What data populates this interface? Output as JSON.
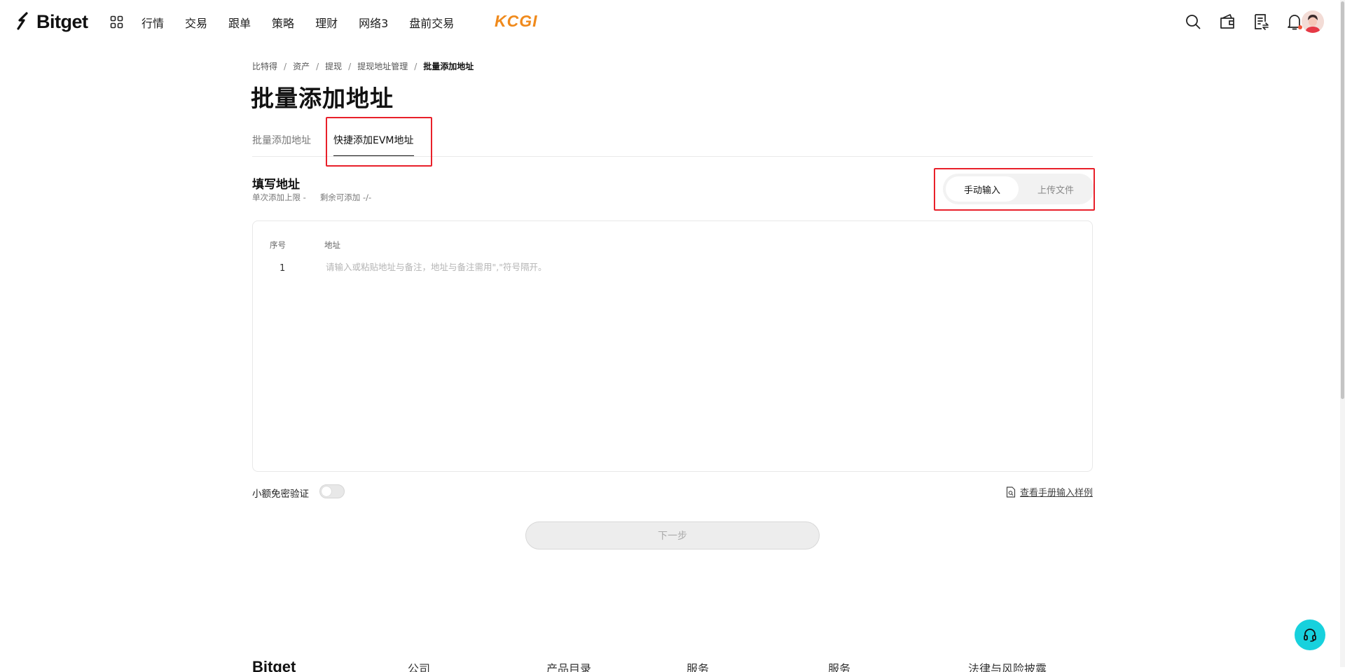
{
  "brand": {
    "name": "Bitget",
    "partner": "KCGI"
  },
  "nav": {
    "items": [
      {
        "label": "行情"
      },
      {
        "label": "交易"
      },
      {
        "label": "跟单"
      },
      {
        "label": "策略"
      },
      {
        "label": "理财"
      },
      {
        "label": "网络3"
      },
      {
        "label": "盘前交易"
      }
    ]
  },
  "breadcrumb": [
    "比特得",
    "资产",
    "提现",
    "提现地址管理",
    "批量添加地址"
  ],
  "breadcrumb_sep": "/",
  "page": {
    "title": "批量添加地址"
  },
  "tabs": [
    {
      "label": "批量添加地址",
      "active": false
    },
    {
      "label": "快捷添加EVM地址",
      "active": true
    }
  ],
  "section": {
    "title": "填写地址",
    "single_limit": "单次添加上限 -",
    "remaining": "剩余可添加 -/-"
  },
  "mode": {
    "manual": "手动输入",
    "upload": "上传文件",
    "selected": "manual"
  },
  "table": {
    "col_index": "序号",
    "col_address": "地址",
    "row_number": "1",
    "placeholder": "请输入或粘贴地址与备注，地址与备注需用\",\"符号隔开。"
  },
  "small_amount": {
    "label": "小额免密验证",
    "enabled": false
  },
  "example_link": "查看手册输入样例",
  "next_button": "下一步",
  "footer_peek": [
    "Bitget",
    "公司",
    "产品目录",
    "服务",
    "服务",
    "法律与风险披露"
  ],
  "colors": {
    "accent_teal": "#17d1dd",
    "highlight_red": "#e8202a",
    "partner_orange": "#f08a1c"
  }
}
